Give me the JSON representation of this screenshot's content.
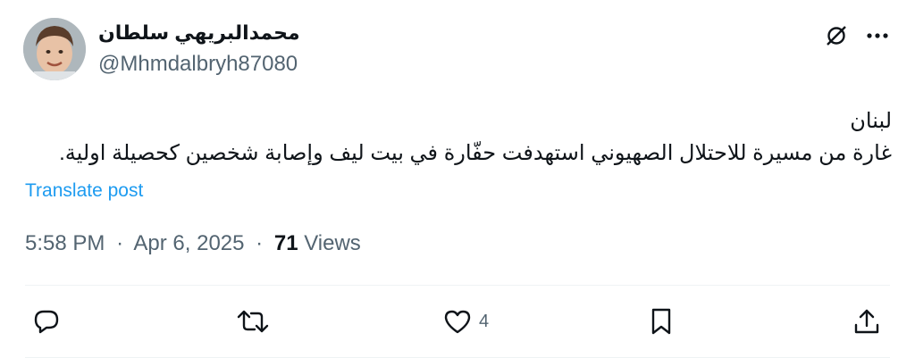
{
  "author": {
    "display_name": "محمدالبريهي سلطان",
    "handle": "@Mhmdalbryh87080"
  },
  "icons": {
    "grok": "grok-icon",
    "more": "more-icon",
    "reply": "reply-icon",
    "repost": "repost-icon",
    "like": "heart-icon",
    "bookmark": "bookmark-icon",
    "share": "share-icon"
  },
  "post": {
    "lines": [
      "لبنان",
      "غارة من مسيرة للاحتلال الصهيوني استهدفت حفّارة في بيت ليف وإصابة شخصين كحصيلة اولية."
    ],
    "translate_label": "Translate post"
  },
  "meta": {
    "time": "5:58 PM",
    "separator": "·",
    "date": "Apr 6, 2025",
    "views_count": "71",
    "views_label": "Views"
  },
  "actions": {
    "like_count": "4"
  },
  "colors": {
    "text": "#0f1419",
    "secondary": "#536471",
    "link": "#1d9bf0",
    "divider": "#eff3f4"
  }
}
